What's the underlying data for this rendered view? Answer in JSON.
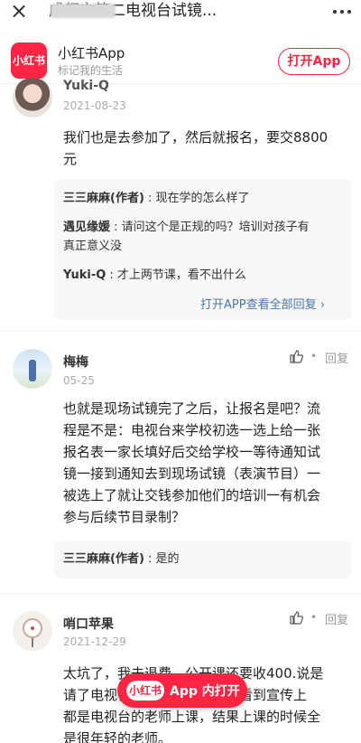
{
  "topbar": {
    "close_label": "×",
    "title": "成都市第二电视台试镜..."
  },
  "banner": {
    "logo_text": "小红书",
    "app_name": "小红书App",
    "slogan": "标记我的生活",
    "open_button": "打开App"
  },
  "comments": [
    {
      "user": "Yuki-Q",
      "date": "2021-08-23",
      "text_lines": [
        "我们也是去参加了，然后就报名，要交8800",
        "元"
      ],
      "replies": [
        {
          "author": "三三麻麻(作者)",
          "text": " : 现在学的怎么样了",
          "lines": [
            "三三麻麻(作者) : 现在学的怎么样了"
          ]
        },
        {
          "author": "遇见缘媛",
          "text": " : 请问这个是正规的吗？培训对孩子有",
          "lines": [
            "遇见缘媛 : 请问这个是正规的吗？培训对孩子有",
            "真正意义没"
          ]
        },
        {
          "author": "Yuki-Q",
          "text": " : 才上两节课，看不出什么",
          "lines": [
            "Yuki-Q : 才上两节课，看不出什么"
          ]
        }
      ],
      "view_all": "打开APP查看全部回复 ›"
    },
    {
      "user": "梅梅",
      "date": "05-25",
      "reply_label": "回复",
      "text_lines": [
        "也就是现场试镜完了之后，让报名是吧？流",
        "程是不是：电视台来学校初选一选上给一张",
        "报名表一家长填好后交给学校一等待通知试",
        "镜一接到通知去到现场试镜（表演节目）一",
        "被选上了就让交钱参加他们的培训一有机会",
        "参与后续节目录制？"
      ],
      "replies": [
        {
          "author": "三三麻麻(作者)",
          "text": " : 是的"
        }
      ]
    },
    {
      "user": "哨口苹果",
      "date": "2021-12-29",
      "reply_label": "回复",
      "text_lines": [
        "太坑了，我去退费，公开课还要收400.说是",
        "请了电视台的老师上课，就是看到宣传上",
        "都是电视台的老师上课，结果上课的时候全",
        "是很年轻的老师。"
      ]
    }
  ],
  "float_button": {
    "logo_text": "小红书",
    "label": "App 内打开"
  },
  "colors": {
    "brand": "#ff2442",
    "link": "#4a76a8"
  }
}
